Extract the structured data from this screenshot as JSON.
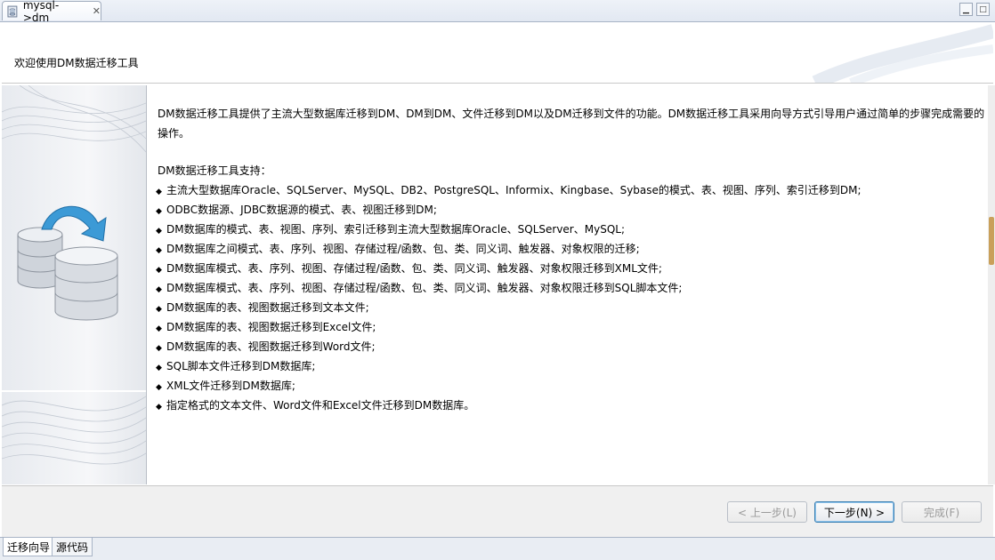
{
  "editor_tab": {
    "title": "mysql->dm",
    "close": "✕"
  },
  "window_controls": [
    "minimize",
    "maximize"
  ],
  "header": {
    "title": "欢迎使用DM数据迁移工具"
  },
  "content": {
    "intro": "DM数据迁移工具提供了主流大型数据库迁移到DM、DM到DM、文件迁移到DM以及DM迁移到文件的功能。DM数据迁移工具采用向导方式引导用户通过简单的步骤完成需要的操作。",
    "support_title": "DM数据迁移工具支持：",
    "bullet": "◆",
    "features": [
      "主流大型数据库Oracle、SQLServer、MySQL、DB2、PostgreSQL、Informix、Kingbase、Sybase的模式、表、视图、序列、索引迁移到DM;",
      "ODBC数据源、JDBC数据源的模式、表、视图迁移到DM;",
      "DM数据库的模式、表、视图、序列、索引迁移到主流大型数据库Oracle、SQLServer、MySQL;",
      "DM数据库之间模式、表、序列、视图、存储过程/函数、包、类、同义词、触发器、对象权限的迁移;",
      "DM数据库模式、表、序列、视图、存储过程/函数、包、类、同义词、触发器、对象权限迁移到XML文件;",
      "DM数据库模式、表、序列、视图、存储过程/函数、包、类、同义词、触发器、对象权限迁移到SQL脚本文件;",
      "DM数据库的表、视图数据迁移到文本文件;",
      "DM数据库的表、视图数据迁移到Excel文件;",
      "DM数据库的表、视图数据迁移到Word文件;",
      "SQL脚本文件迁移到DM数据库;",
      "XML文件迁移到DM数据库;",
      "指定格式的文本文件、Word文件和Excel文件迁移到DM数据库。"
    ]
  },
  "buttons": {
    "prev": "< 上一步(L)",
    "next": "下一步(N) >",
    "finish": "完成(F)"
  },
  "bottom_tabs": [
    "迁移向导",
    "源代码"
  ],
  "colors": {
    "accent_button_border": "#3c7fb1",
    "scroll_thumb": "#c9a05a"
  }
}
